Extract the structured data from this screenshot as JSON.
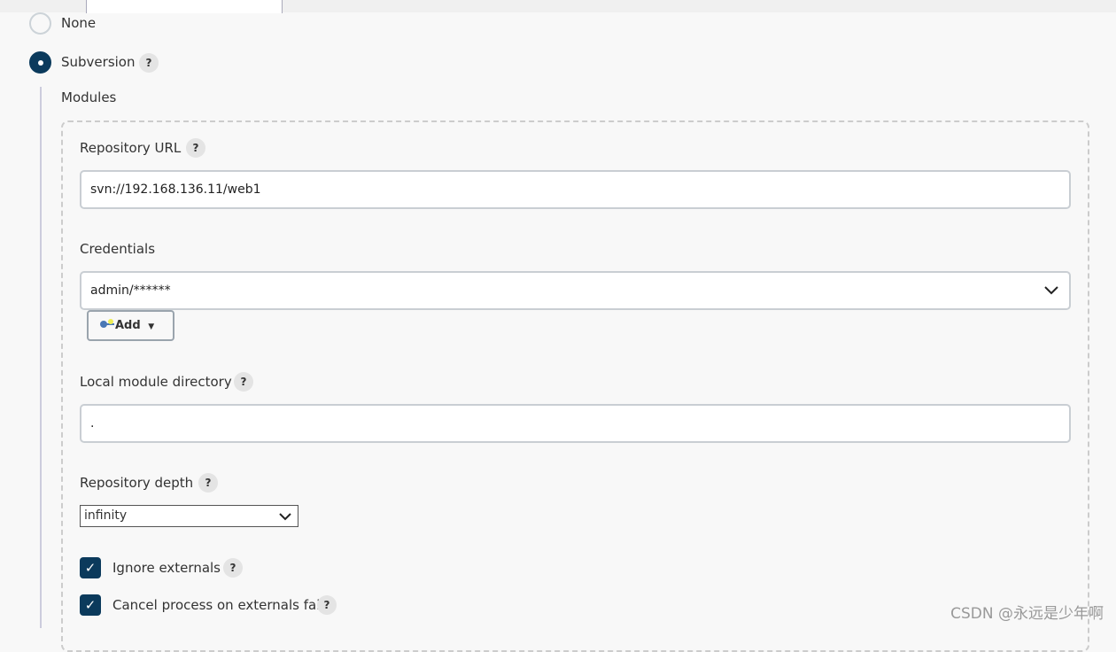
{
  "scm": {
    "none_label": "None",
    "svn_label": "Subversion",
    "modules_label": "Modules"
  },
  "module": {
    "repo_url_label": "Repository URL",
    "repo_url_value": "svn://192.168.136.11/web1",
    "credentials_label": "Credentials",
    "credentials_value": "admin/******",
    "add_label": "Add",
    "local_dir_label": "Local module directory",
    "local_dir_value": ".",
    "depth_label": "Repository depth",
    "depth_value": "infinity",
    "ignore_externals_label": "Ignore externals",
    "ignore_externals_checked": true,
    "cancel_externals_label": "Cancel process on externals fail",
    "cancel_externals_checked": true
  },
  "help": "?",
  "watermark": "CSDN @永远是少年啊"
}
